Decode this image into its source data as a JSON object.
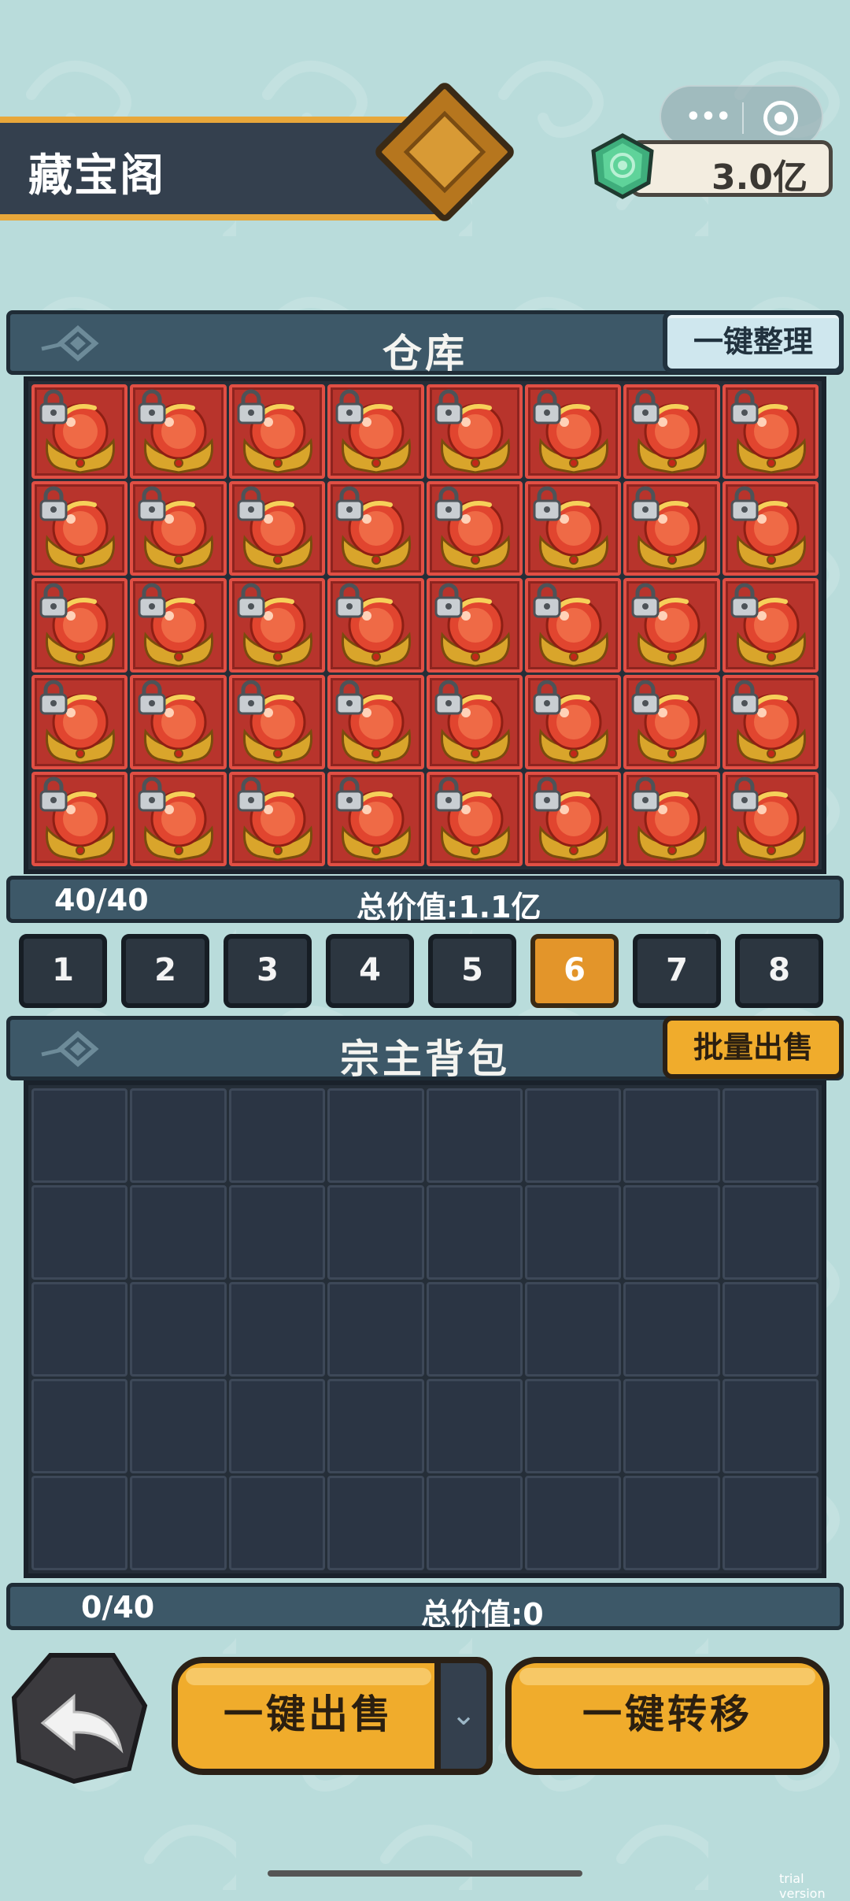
{
  "header": {
    "title": "藏宝阁"
  },
  "capsule": {
    "more_label": "•••"
  },
  "currency": {
    "value": "3.0亿",
    "icon": "green-gem-icon"
  },
  "warehouse": {
    "title": "仓库",
    "sort_button": "一键整理",
    "count": "40/40",
    "total_value": "总价值:1.1亿",
    "columns": 8,
    "rows": 5,
    "item_icon": "red-orb-treasure-icon",
    "locked": true
  },
  "pages": {
    "tabs": [
      "1",
      "2",
      "3",
      "4",
      "5",
      "6",
      "7",
      "8"
    ],
    "active": "6"
  },
  "backpack": {
    "title": "宗主背包",
    "batch_sell_button": "批量出售",
    "count": "0/40",
    "total_value": "总价值:0",
    "columns": 8,
    "rows": 5
  },
  "actions": {
    "back_icon": "back-arrow-icon",
    "sell_all": "一键出售",
    "dropdown_icon": "chevron-down-icon",
    "transfer_all": "一键转移"
  },
  "watermark": "trial version",
  "colors": {
    "background": "#b9dcdb",
    "panel": "#3d5868",
    "accent": "#f0ac2c",
    "item_slot": "#b8342c"
  }
}
